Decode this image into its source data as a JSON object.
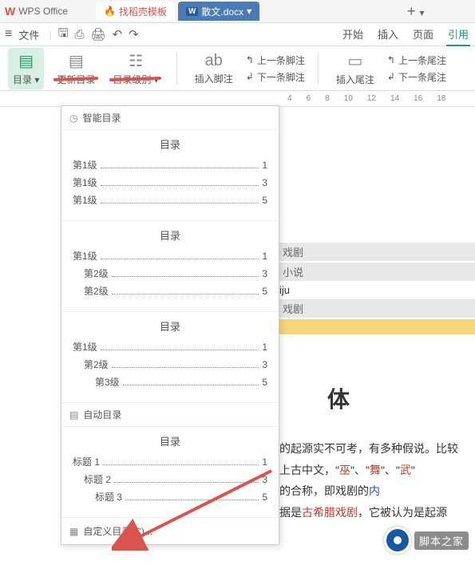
{
  "titlebar": {
    "app_name": "WPS Office"
  },
  "doctabs": {
    "template": "找稻壳模板",
    "active": "散文.docx",
    "active_icon": "W",
    "plus": "+"
  },
  "toolbar": {
    "menu": "≡",
    "file": "文件",
    "tabs": {
      "start": "开始",
      "insert": "插入",
      "page": "页面",
      "ref": "引用"
    }
  },
  "ribbon": {
    "toc": "目录",
    "update_toc": "更新目录",
    "toc_level": "目录级别",
    "ab": "ab",
    "insert_footnote": "插入脚注",
    "prev_footnote": "上一条脚注",
    "next_footnote": "下一条脚注",
    "insert_endnote": "插入尾注",
    "prev_endnote": "上一条尾注",
    "next_endnote": "下一条尾注"
  },
  "ruler": {
    "marks": [
      "4",
      "6",
      "8",
      "10",
      "12",
      "14",
      "16",
      "18"
    ]
  },
  "dropdown": {
    "smart_toc": "智能目录",
    "auto_toc": "自动目录",
    "custom_toc": "自定义目录(C)...",
    "sections": [
      {
        "title": "目录",
        "rows": [
          {
            "label": "第1级",
            "page": "1",
            "indent": 0
          },
          {
            "label": "第1级",
            "page": "3",
            "indent": 0
          },
          {
            "label": "第1级",
            "page": "5",
            "indent": 0
          }
        ]
      },
      {
        "title": "目录",
        "rows": [
          {
            "label": "第1级",
            "page": "1",
            "indent": 0
          },
          {
            "label": "第2级",
            "page": "3",
            "indent": 1
          },
          {
            "label": "第2级",
            "page": "5",
            "indent": 1
          }
        ]
      },
      {
        "title": "目录",
        "rows": [
          {
            "label": "第1级",
            "page": "1",
            "indent": 0
          },
          {
            "label": "第2级",
            "page": "3",
            "indent": 1
          },
          {
            "label": "第3级",
            "page": "5",
            "indent": 2
          }
        ]
      }
    ],
    "auto_section": {
      "title": "目录",
      "rows": [
        {
          "label": "标题 1",
          "page": "1",
          "indent": 0
        },
        {
          "label": "标题 2",
          "page": "3",
          "indent": 1
        },
        {
          "label": "标题 3",
          "page": "5",
          "indent": 2
        }
      ]
    }
  },
  "document": {
    "lines": [
      "戏剧",
      "小说",
      "iju",
      "戏剧"
    ],
    "heading": "体",
    "para_prefix": "的起源实不可考，有多种假说。比较",
    "para_l2a": "上古中文，\"",
    "para_w1": "巫",
    "para_l2b": "\"、\"",
    "para_w2": "舞",
    "para_l2c": "\"、\"",
    "para_w3": "武",
    "para_l2d": "\"",
    "para_l3a": "的合称，即戏剧的",
    "para_l3b": "内",
    "para_l4a": "据是",
    "para_w4": "古希腊戏剧",
    "para_l4b": "，它被认为是起源"
  },
  "watermark": {
    "text": "脚本之家"
  }
}
